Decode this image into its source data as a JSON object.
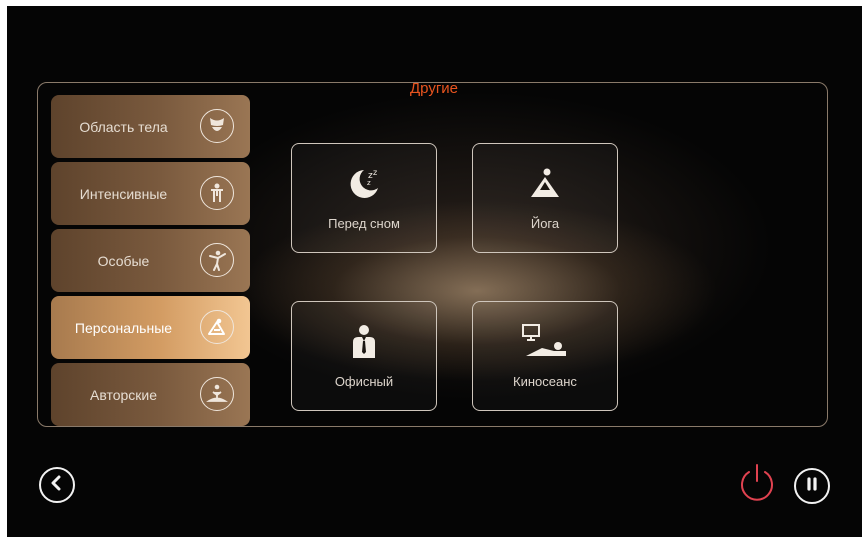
{
  "panel": {
    "title": "Другие"
  },
  "sidebar": {
    "items": [
      {
        "label": "Область тела",
        "icon": "body-area-icon",
        "active": false
      },
      {
        "label": "Интенсивные",
        "icon": "intense-person-icon",
        "active": false
      },
      {
        "label": "Особые",
        "icon": "special-pose-icon",
        "active": false
      },
      {
        "label": "Персональные",
        "icon": "personal-yoga-icon",
        "active": true
      },
      {
        "label": "Авторские",
        "icon": "author-massage-icon",
        "active": false
      }
    ]
  },
  "programs": [
    {
      "label": "Перед сном",
      "icon": "moon-sleep-icon"
    },
    {
      "label": "Йога",
      "icon": "yoga-icon"
    },
    {
      "label": "Офисный",
      "icon": "office-worker-icon"
    },
    {
      "label": "Киносеанс",
      "icon": "movie-watch-icon"
    }
  ],
  "controls": {
    "back": "back-chevron-icon",
    "power": "power-icon",
    "pause": "pause-icon",
    "power_color": "#e04250"
  }
}
